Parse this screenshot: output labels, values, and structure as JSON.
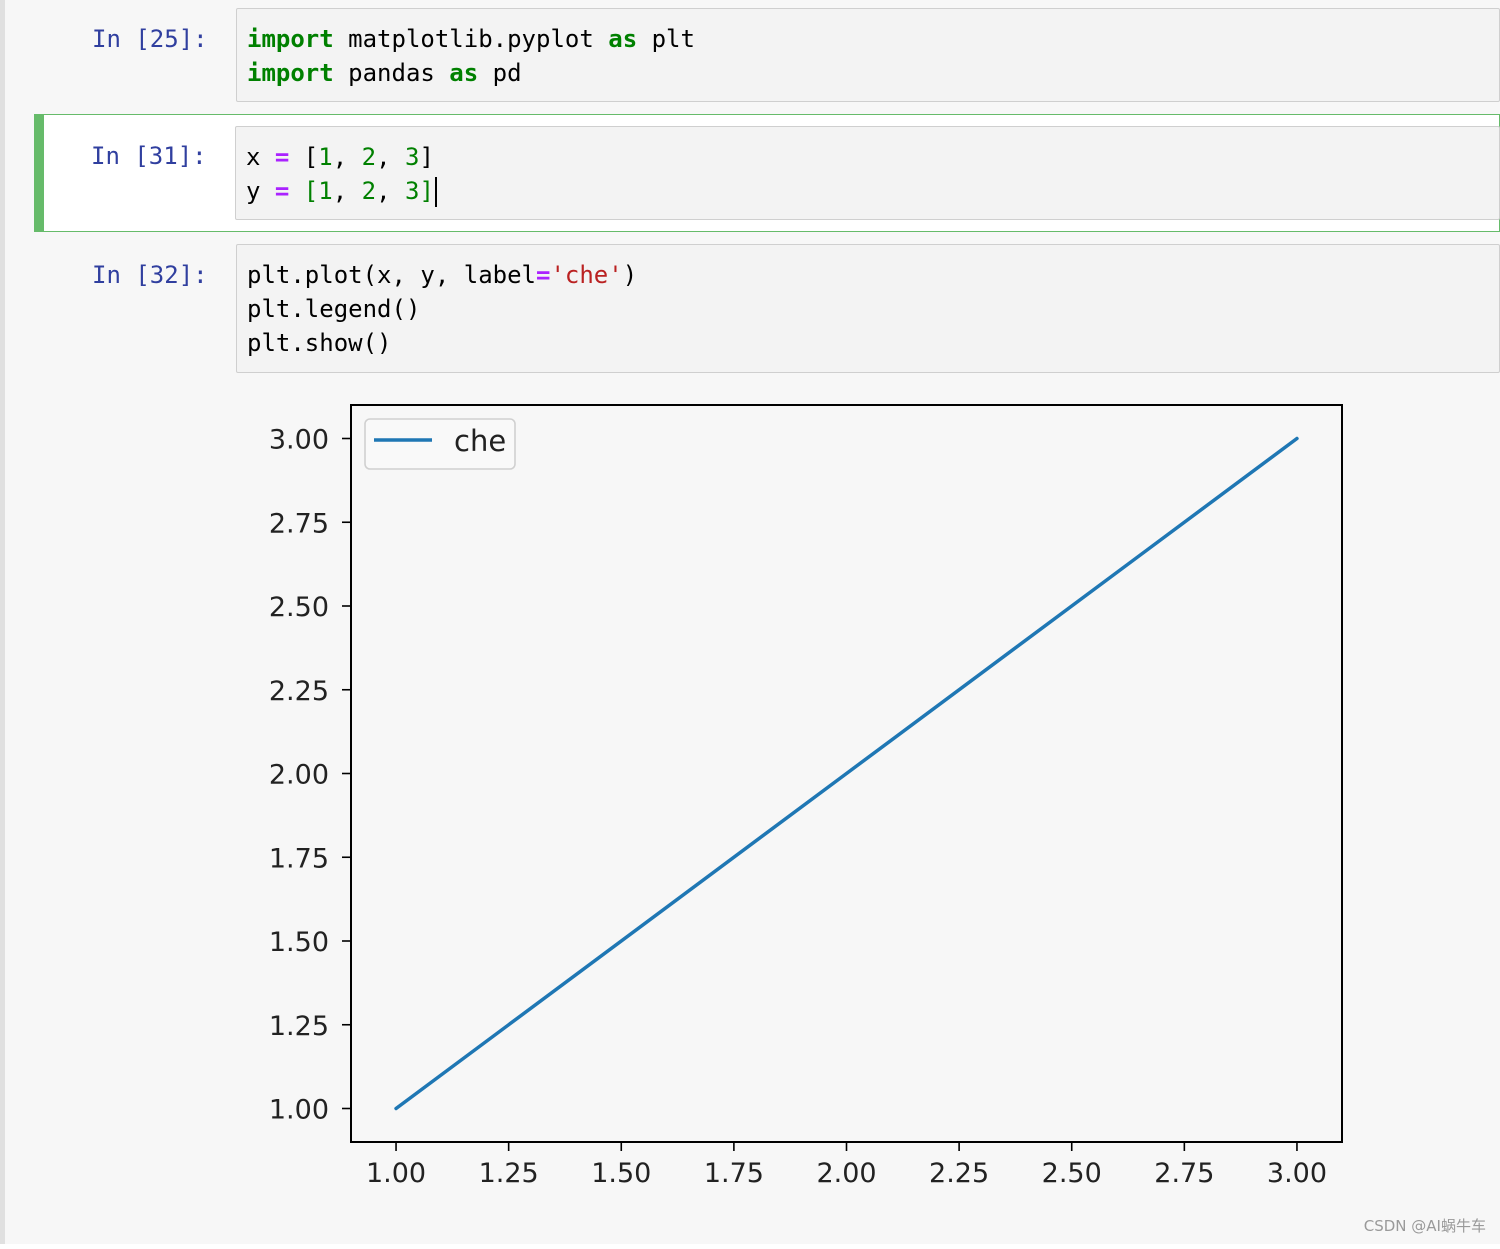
{
  "notebook": {
    "cells": [
      {
        "prompt": "In [25]:",
        "lines": [
          [
            {
              "t": "import",
              "c": "kw"
            },
            {
              "t": " matplotlib.pyplot ",
              "c": "plain"
            },
            {
              "t": "as",
              "c": "kw"
            },
            {
              "t": " plt",
              "c": "plain"
            }
          ],
          [
            {
              "t": "import",
              "c": "kw"
            },
            {
              "t": " pandas ",
              "c": "plain"
            },
            {
              "t": "as",
              "c": "kw"
            },
            {
              "t": " pd",
              "c": "plain"
            }
          ]
        ]
      },
      {
        "prompt": "In [31]:",
        "selected": true,
        "lines": [
          [
            {
              "t": "x ",
              "c": "plain"
            },
            {
              "t": "=",
              "c": "op"
            },
            {
              "t": " [",
              "c": "plain"
            },
            {
              "t": "1",
              "c": "num"
            },
            {
              "t": ", ",
              "c": "plain"
            },
            {
              "t": "2",
              "c": "num"
            },
            {
              "t": ", ",
              "c": "plain"
            },
            {
              "t": "3",
              "c": "num"
            },
            {
              "t": "]",
              "c": "plain"
            }
          ],
          [
            {
              "t": "y ",
              "c": "plain"
            },
            {
              "t": "=",
              "c": "op"
            },
            {
              "t": " [",
              "c": "num"
            },
            {
              "t": "1",
              "c": "num"
            },
            {
              "t": ", ",
              "c": "plain"
            },
            {
              "t": "2",
              "c": "num"
            },
            {
              "t": ", ",
              "c": "plain"
            },
            {
              "t": "3",
              "c": "num"
            },
            {
              "t": "]",
              "c": "num"
            }
          ]
        ]
      },
      {
        "prompt": "In [32]:",
        "lines": [
          [
            {
              "t": "plt.plot(x, y, label",
              "c": "plain"
            },
            {
              "t": "=",
              "c": "op"
            },
            {
              "t": "'che'",
              "c": "str"
            },
            {
              "t": ")",
              "c": "plain"
            }
          ],
          [
            {
              "t": "plt.legend()",
              "c": "plain"
            }
          ],
          [
            {
              "t": "plt.show()",
              "c": "plain"
            }
          ]
        ]
      }
    ]
  },
  "chart_data": {
    "type": "line",
    "title": "",
    "xlabel": "",
    "ylabel": "",
    "xlim": [
      0.9,
      3.1
    ],
    "ylim": [
      0.9,
      3.1
    ],
    "xticks": [
      1.0,
      1.25,
      1.5,
      1.75,
      2.0,
      2.25,
      2.5,
      2.75,
      3.0
    ],
    "xtick_labels": [
      "1.00",
      "1.25",
      "1.50",
      "1.75",
      "2.00",
      "2.25",
      "2.50",
      "2.75",
      "3.00"
    ],
    "yticks": [
      1.0,
      1.25,
      1.5,
      1.75,
      2.0,
      2.25,
      2.5,
      2.75,
      3.0
    ],
    "ytick_labels": [
      "1.00",
      "1.25",
      "1.50",
      "1.75",
      "2.00",
      "2.25",
      "2.50",
      "2.75",
      "3.00"
    ],
    "grid": false,
    "legend_position": "upper left",
    "series": [
      {
        "name": "che",
        "color": "#1f77b4",
        "x": [
          1,
          2,
          3
        ],
        "y": [
          1,
          2,
          3
        ]
      }
    ]
  },
  "watermark": "CSDN @AI蜗牛车"
}
